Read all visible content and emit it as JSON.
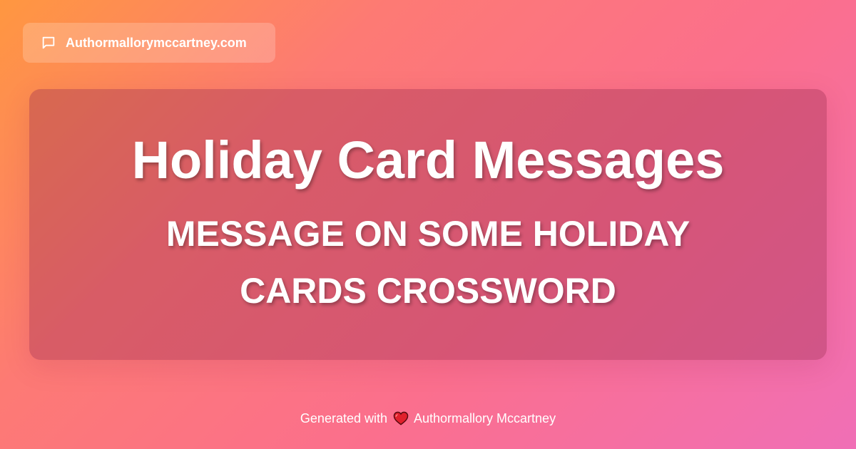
{
  "site": {
    "domain": "Authormallorymccartney.com",
    "icon": "chat-bubble-icon"
  },
  "card": {
    "title": "Holiday Card Messages",
    "subtitle": "MESSAGE ON SOME HOLIDAY CARDS CROSSWORD"
  },
  "footer": {
    "prefix": "Generated with",
    "heart_icon": "heart-icon",
    "author": "Authormallory Mccartney"
  },
  "colors": {
    "gradient_start": "#ff9740",
    "gradient_end": "#f06fb6",
    "text": "#ffffff",
    "heart": "#e0202c"
  }
}
